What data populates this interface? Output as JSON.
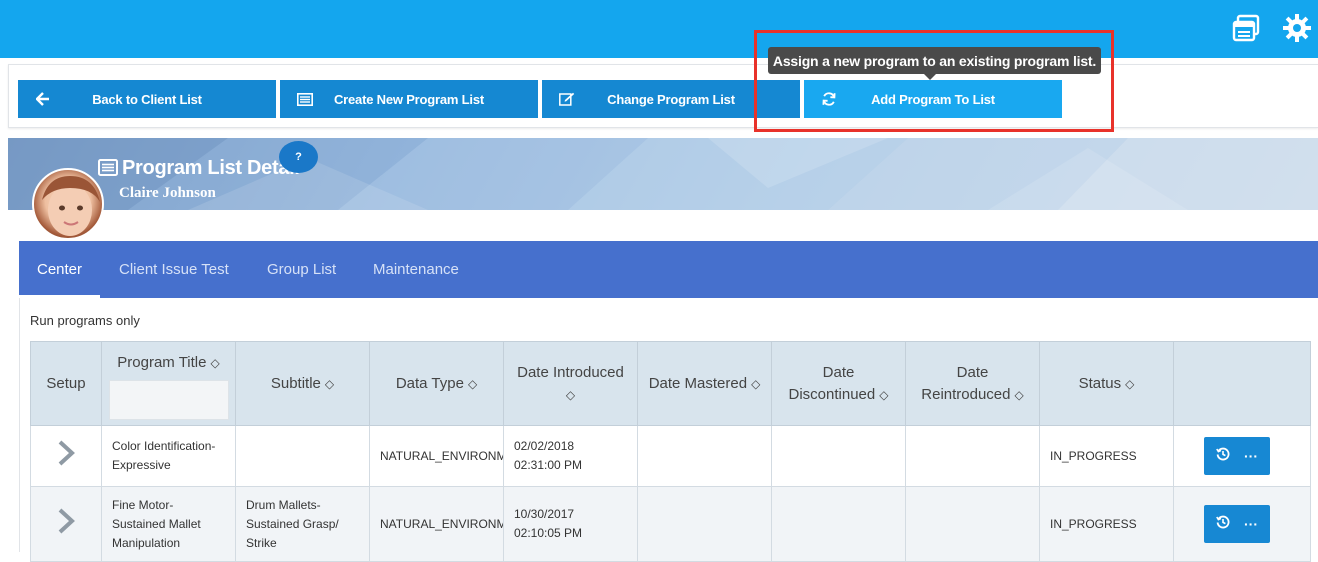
{
  "topbar": {
    "icons": [
      "window-icon",
      "gear-icon"
    ],
    "accent": "#14a6ee"
  },
  "toolbar": {
    "buttons": [
      {
        "label": "Back to Client List",
        "icon": "arrow-left-icon"
      },
      {
        "label": "Create New Program List",
        "icon": "list-icon"
      },
      {
        "label": "Change Program List",
        "icon": "edit-icon"
      },
      {
        "label": "Add Program To List",
        "icon": "refresh-icon"
      }
    ],
    "tooltip": "Assign a new program to an existing program list."
  },
  "banner": {
    "title": "Program List Detail",
    "client_name": "Claire Johnson",
    "help_label": "?"
  },
  "tabs": [
    {
      "label": "Center",
      "active": true
    },
    {
      "label": "Client Issue Test",
      "active": false
    },
    {
      "label": "Group List",
      "active": false
    },
    {
      "label": "Maintenance",
      "active": false
    }
  ],
  "main": {
    "run_only_label": "Run programs only",
    "sort_glyph": "◇",
    "columns": {
      "setup": "Setup",
      "program_title": "Program Title",
      "subtitle": "Subtitle",
      "data_type": "Data Type",
      "date_introduced_1": "Date Introduced",
      "date_mastered": "Date Mastered",
      "date_discontinued_1": "Date",
      "date_discontinued_2": "Discontinued",
      "date_reintroduced_1": "Date",
      "date_reintroduced_2": "Reintroduced",
      "status": "Status"
    },
    "rows": [
      {
        "program_title_1": "Color Identification-",
        "program_title_2": "Expressive",
        "subtitle_1": "",
        "subtitle_2": "",
        "subtitle_3": "",
        "data_type": "NATURAL_ENVIRONMENT",
        "date_introduced_1": "02/02/2018",
        "date_introduced_2": "02:31:00 PM",
        "status": "IN_PROGRESS"
      },
      {
        "program_title_1": "Fine Motor-",
        "program_title_2": "Sustained Mallet",
        "program_title_3": "Manipulation",
        "subtitle_1": "Drum Mallets-",
        "subtitle_2": "Sustained Grasp/",
        "subtitle_3": "Strike",
        "data_type": "NATURAL_ENVIRONMENT",
        "date_introduced_1": "10/30/2017",
        "date_introduced_2": "02:10:05 PM",
        "status": "IN_PROGRESS"
      }
    ],
    "row_action_icons": [
      "history-icon",
      "more-icon"
    ],
    "row_action_more": "···"
  }
}
